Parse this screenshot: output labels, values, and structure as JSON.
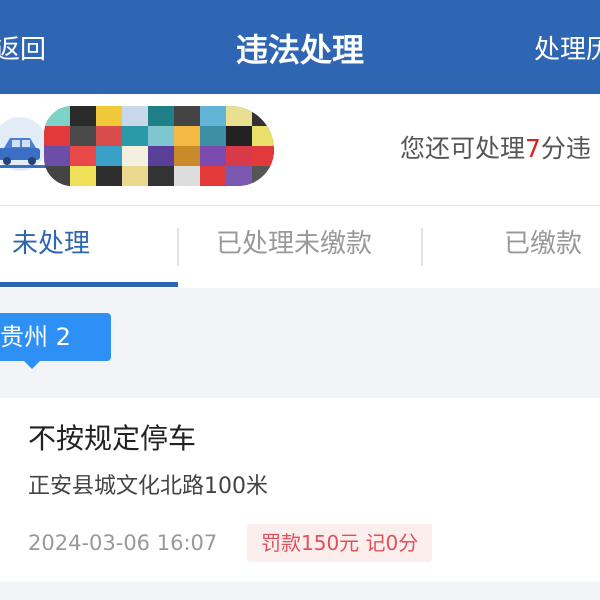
{
  "header": {
    "back_label": "返回",
    "title": "违法处理",
    "right_label": "处理历"
  },
  "info_bar": {
    "car_icon": "car-icon",
    "plate_obscured": true,
    "remain_prefix": "您还可处理",
    "remain_count": "7",
    "remain_suffix": "分违"
  },
  "tabs": [
    {
      "label": "未处理",
      "active": true
    },
    {
      "label": "已处理未缴款",
      "active": false
    },
    {
      "label": "已缴款",
      "active": false
    }
  ],
  "region": {
    "label": "贵州 2"
  },
  "violations": [
    {
      "title": "不按规定停车",
      "address": "正安县城文化北路100米",
      "time": "2024-03-06 16:07",
      "fine": "罚款150元 记0分"
    }
  ],
  "colors": {
    "primary": "#2f66b3",
    "tag_blue": "#2e8ff5",
    "warn_red": "#e02020",
    "fine_bg": "#fdeeee",
    "fine_text": "#e0505a"
  }
}
